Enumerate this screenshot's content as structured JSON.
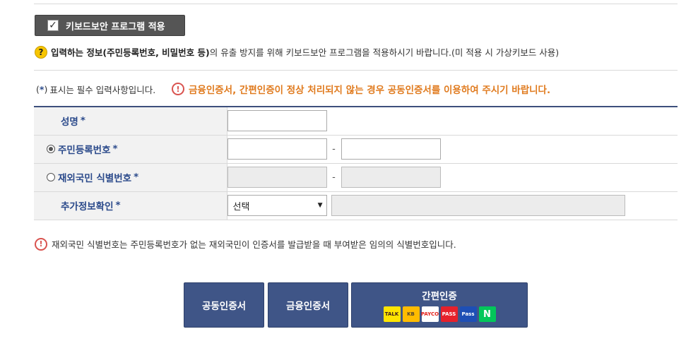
{
  "keyboard_security": {
    "label": "키보드보안 프로그램 적용",
    "checked": true,
    "check_glyph": "✓"
  },
  "notice1": {
    "icon_glyph": "?",
    "bold_text": "입력하는 정보(주민등록번호, 비밀번호 등)",
    "rest_text": "의 유출 방지를 위해 키보드보안 프로그램을 적용하시기 바랍니다.(미 적용 시 가상키보드 사용)"
  },
  "required_note": {
    "open": "(",
    "star": "*",
    "close": ")",
    "text": "표시는 필수 입력사항입니다."
  },
  "warning": {
    "icon_glyph": "!",
    "text": "금융인증서, 간편인증이 정상 처리되지 않는 경우 공동인증서를 이용하여 주시기 바랍니다."
  },
  "form": {
    "name_label": "성명",
    "star": "*",
    "resident_label": "주민등록번호",
    "resident_selected": true,
    "foreign_label": "재외국민 식별번호",
    "foreign_selected": false,
    "extra_label": "추가정보확인",
    "dash": "-",
    "select_value": "선택",
    "select_arrow": "▼"
  },
  "foreign_note": {
    "icon_glyph": "!",
    "text": "재외국민 식별번호는 주민등록번호가 없는 재외국민이 인증서를 발급받을 때 부여받은 임의의 식별번호입니다."
  },
  "buttons": {
    "joint_cert": "공동인증서",
    "financial_cert": "금융인증서",
    "easy_auth": "간편인증",
    "logos": [
      {
        "name": "kakao-talk-logo",
        "label": "TALK",
        "bg": "#fee500",
        "fg": "#3c1e1e"
      },
      {
        "name": "kb-logo",
        "label": "KB",
        "bg": "#ffbc00",
        "fg": "#55462f"
      },
      {
        "name": "payco-logo",
        "label": "PAYCO",
        "bg": "#ffffff",
        "fg": "#e5211b"
      },
      {
        "name": "pass-logo",
        "label": "PASS",
        "bg": "#e6212b",
        "fg": "#ffffff"
      },
      {
        "name": "samsung-pass-logo",
        "label": "Pass",
        "bg": "#1e4fb5",
        "fg": "#ffffff"
      },
      {
        "name": "naver-logo",
        "label": "N",
        "bg": "#03c75a",
        "fg": "#ffffff"
      }
    ]
  }
}
